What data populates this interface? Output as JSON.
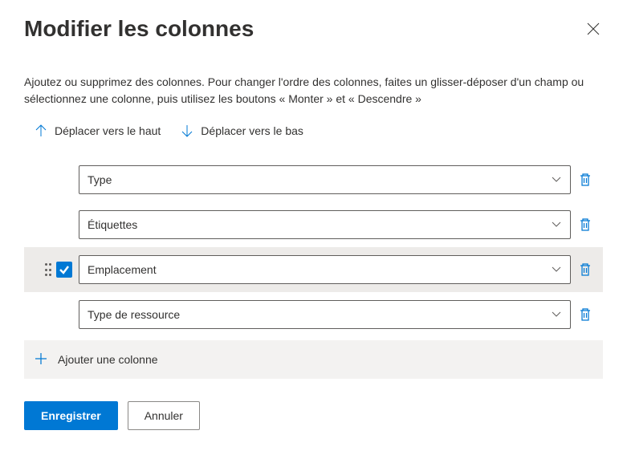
{
  "title": "Modifier les colonnes",
  "description": "Ajoutez ou supprimez des colonnes. Pour changer l'ordre des colonnes, faites un glisser-déposer d'un champ ou sélectionnez une colonne, puis utilisez les boutons « Monter » et « Descendre »",
  "toolbar": {
    "move_up": "Déplacer vers le haut",
    "move_down": "Déplacer vers le bas"
  },
  "columns": [
    {
      "label": "Type",
      "selected": false
    },
    {
      "label": "Étiquettes",
      "selected": false
    },
    {
      "label": "Emplacement",
      "selected": true
    },
    {
      "label": "Type de ressource",
      "selected": false
    }
  ],
  "add_label": "Ajouter une colonne",
  "footer": {
    "save": "Enregistrer",
    "cancel": "Annuler"
  }
}
